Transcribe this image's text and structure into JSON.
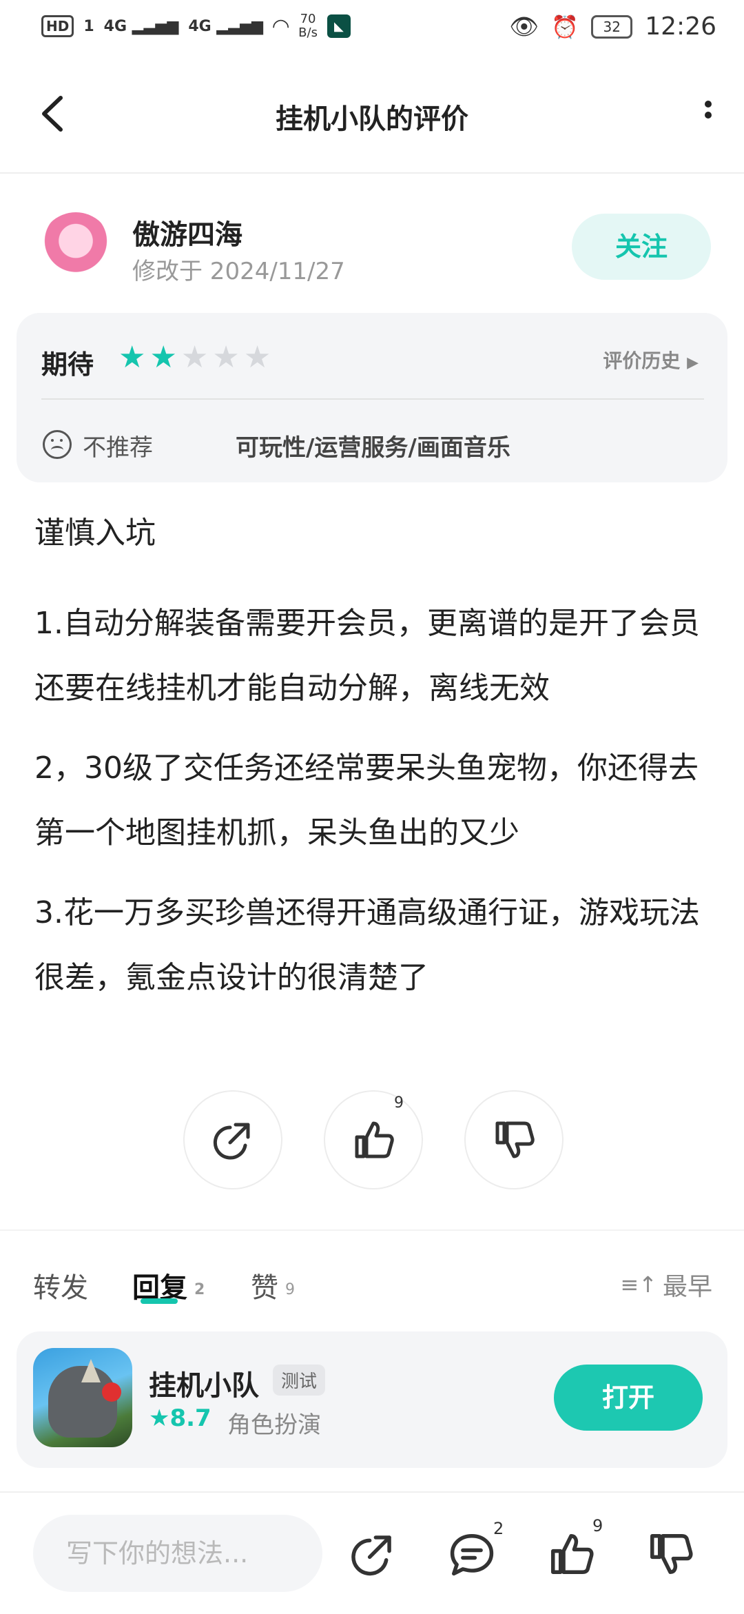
{
  "status_bar": {
    "hd": "HD",
    "sim": "1",
    "net1": "4G",
    "net2": "4G",
    "speed_value": "70",
    "speed_unit": "B/s",
    "battery": "32",
    "time": "12:26"
  },
  "header": {
    "title": "挂机小队的评价"
  },
  "user": {
    "name": "傲游四海",
    "date": "修改于 2024/11/27",
    "follow_label": "关注"
  },
  "rating": {
    "label": "期待",
    "stars": 2,
    "max_stars": 5,
    "history_label": "评价历史",
    "recommend": "不推荐",
    "tags": "可玩性/运营服务/画面音乐"
  },
  "review": {
    "lines": [
      "谨慎入坑",
      "1.自动分解装备需要开会员，更离谱的是开了会员还要在线挂机才能自动分解，离线无效",
      "2，30级了交任务还经常要呆头鱼宠物，你还得去第一个地图挂机抓，呆头鱼出的又少",
      "3.花一万多买珍兽还得开通高级通行证，游戏玩法很差，氪金点设计的很清楚了"
    ]
  },
  "actions": {
    "like_count": "9"
  },
  "tabs": {
    "forward": "转发",
    "reply": "回复",
    "reply_count": "2",
    "like": "赞",
    "like_count": "9",
    "sort": "最早"
  },
  "game": {
    "name": "挂机小队",
    "tag": "测试",
    "rating": "★8.7",
    "genre": "角色扮演",
    "open_label": "打开"
  },
  "bottom": {
    "placeholder": "写下你的想法...",
    "comment_count": "2",
    "like_count": "9"
  },
  "colors": {
    "accent": "#15c5ae",
    "follow_bg": "#e4f7f5",
    "card_bg": "#f4f5f7"
  }
}
